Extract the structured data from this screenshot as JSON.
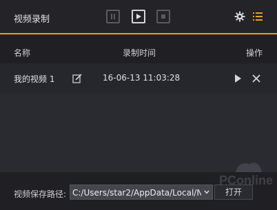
{
  "app": {
    "title": "视频录制"
  },
  "toolbar": {
    "pause_icon": "pause-icon",
    "play_icon": "play-icon",
    "stop_icon": "stop-icon",
    "settings_icon": "gear-icon",
    "list_icon": "list-icon",
    "accent": "#e8a020"
  },
  "table": {
    "headers": {
      "name": "名称",
      "time": "录制时间",
      "ops": "操作"
    },
    "rows": [
      {
        "name": "我的视频 1",
        "time": "16-06-13 11:03:28"
      }
    ]
  },
  "footer": {
    "save_path_label": "视频保存路径:",
    "save_path_value": "C:/Users/star2/AppData/Local/N",
    "open_button": "打开"
  },
  "watermark": {
    "text": "PConline"
  }
}
